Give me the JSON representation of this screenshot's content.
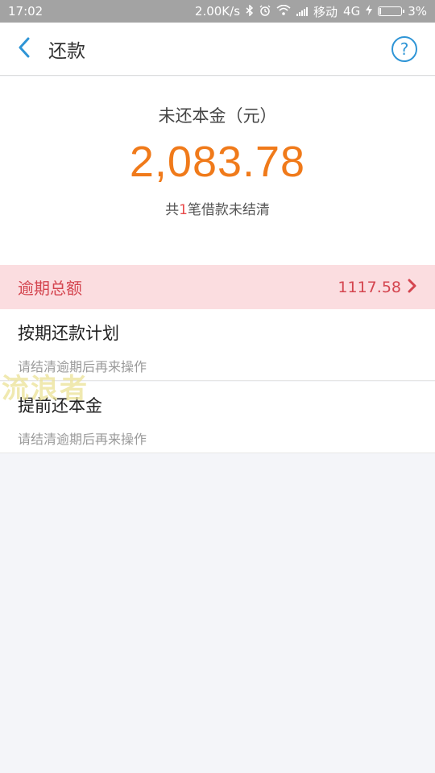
{
  "status_bar": {
    "time": "17:02",
    "speed": "2.00K/s",
    "carrier": "移动",
    "network": "4G",
    "battery": "3%"
  },
  "header": {
    "title": "还款",
    "help_icon": "question-mark",
    "back_icon": "chevron-left"
  },
  "summary": {
    "label": "未还本金（元）",
    "amount": "2,083.78",
    "sub_prefix": "共",
    "sub_count": "1",
    "sub_suffix": "笔借款未结清"
  },
  "overdue": {
    "label": "逾期总额",
    "amount": "1117.58"
  },
  "items": [
    {
      "title": "按期还款计划",
      "desc": "请结清逾期后再来操作"
    },
    {
      "title": "提前还本金",
      "desc": "请结清逾期后再来操作"
    }
  ],
  "watermark": "流浪者",
  "colors": {
    "accent_blue": "#2f95d6",
    "amount_orange": "#f07a1a",
    "overdue_red": "#d4454f",
    "overdue_bg": "#fbdde0"
  }
}
